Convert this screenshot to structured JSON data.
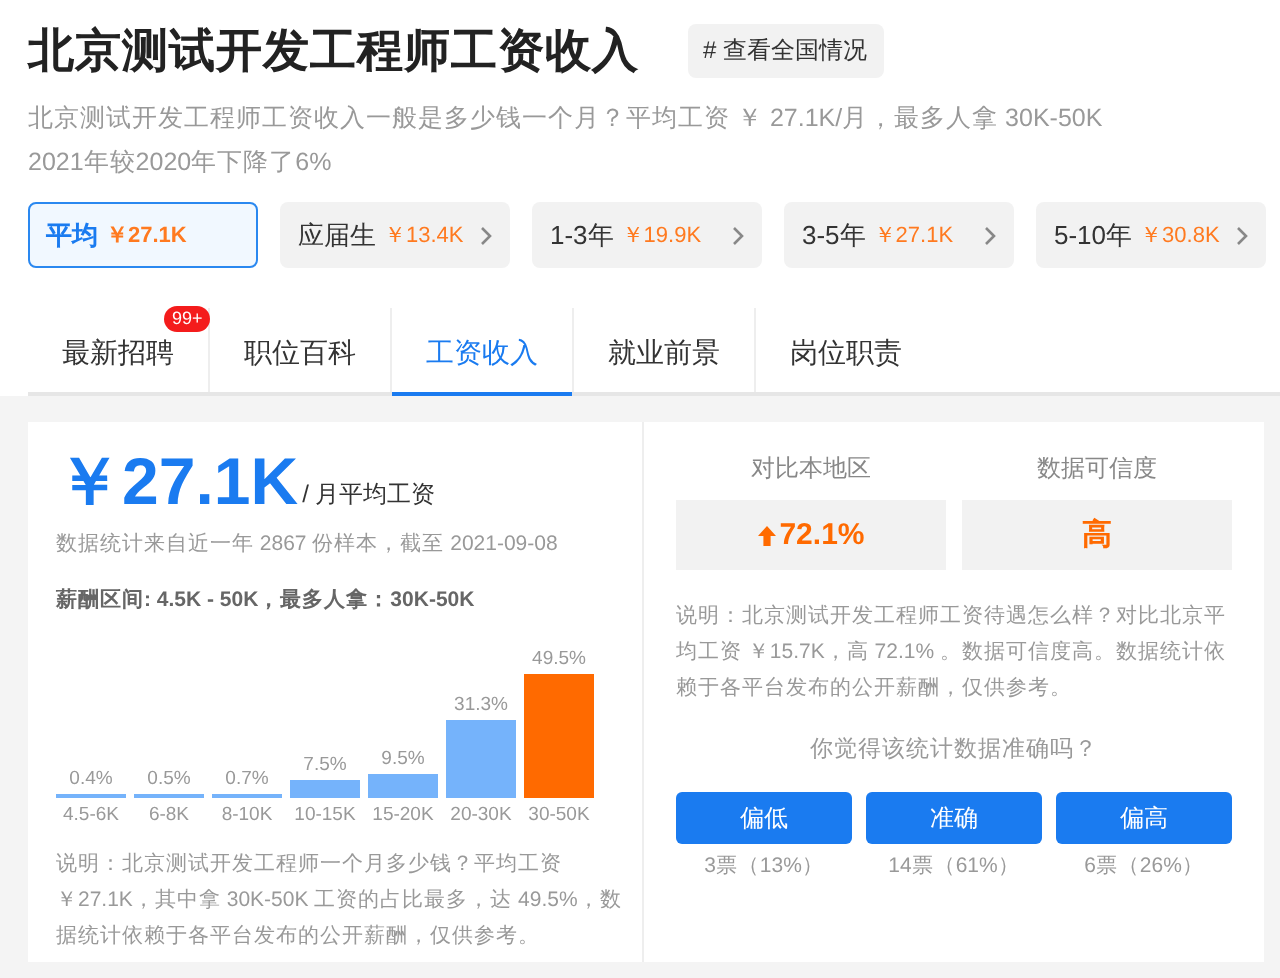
{
  "header": {
    "title": "北京测试开发工程师工资收入",
    "tag": "# 查看全国情况",
    "summary": [
      "北京测试开发工程师工资收入一般是多少钱一个月？平均工资 ￥ 27.1K/月，最多人拿 30K-50K",
      "2021年较2020年下降了6%"
    ]
  },
  "levels": [
    {
      "label": "平均",
      "salary": "￥27.1K",
      "selected": true
    },
    {
      "label": "应届生",
      "salary": "￥13.4K",
      "selected": false
    },
    {
      "label": "1-3年",
      "salary": "￥19.9K",
      "selected": false
    },
    {
      "label": "3-5年",
      "salary": "￥27.1K",
      "selected": false
    },
    {
      "label": "5-10年",
      "salary": "￥30.8K",
      "selected": false
    }
  ],
  "tabs": [
    {
      "label": "最新招聘",
      "badge": "99+",
      "selected": false
    },
    {
      "label": "职位百科",
      "selected": false
    },
    {
      "label": "工资收入",
      "selected": true
    },
    {
      "label": "就业前景",
      "selected": false
    },
    {
      "label": "岗位职责",
      "selected": false
    }
  ],
  "salary_panel": {
    "amount": "￥27.1K",
    "unit": "/ 月平均工资",
    "sample_note": "数据统计来自近一年 2867 份样本，截至 2021-09-08",
    "range": "薪酬区间: 4.5K - 50K，最多人拿：30K-50K",
    "chart_data": {
      "type": "bar",
      "categories": [
        "4.5-6K",
        "6-8K",
        "8-10K",
        "10-15K",
        "15-20K",
        "20-30K",
        "30-50K"
      ],
      "series": [
        {
          "color": "#75b3fb",
          "values": [
            0.4,
            0.5,
            0.7,
            7.5,
            9.5,
            31.3,
            null
          ],
          "value_labels": [
            "0.4%",
            "0.5%",
            "0.7%",
            "7.5%",
            "9.5%",
            "31.3%",
            null
          ]
        },
        {
          "color": "#ff6a00",
          "values": [
            null,
            null,
            null,
            null,
            null,
            null,
            49.5
          ],
          "value_labels": [
            null,
            null,
            null,
            null,
            null,
            null,
            "49.5%"
          ]
        }
      ]
    },
    "explanation": "说明：北京测试开发工程师一个月多少钱？平均工资￥27.1K，其中拿 30K-50K 工资的占比最多，达 49.5%，数据统计依赖于各平台发布的公开薪酬，仅供参考。"
  },
  "compare_panel": {
    "stats": [
      {
        "label": "对比本地区",
        "value": "72.1%",
        "kind": "up"
      },
      {
        "label": "数据可信度",
        "value": "高",
        "kind": "plain"
      }
    ],
    "explanation": "说明：北京测试开发工程师工资待遇怎么样？对比北京平均工资 ￥15.7K，高 72.1% 。数据可信度高。数据统计依赖于各平台发布的公开薪酬，仅供参考。",
    "question": "你觉得该统计数据准确吗？",
    "votes": [
      {
        "label": "偏低",
        "count": "3票（13%）"
      },
      {
        "label": "准确",
        "count": "14票（61%）"
      },
      {
        "label": "偏高",
        "count": "6票（26%）"
      }
    ]
  }
}
